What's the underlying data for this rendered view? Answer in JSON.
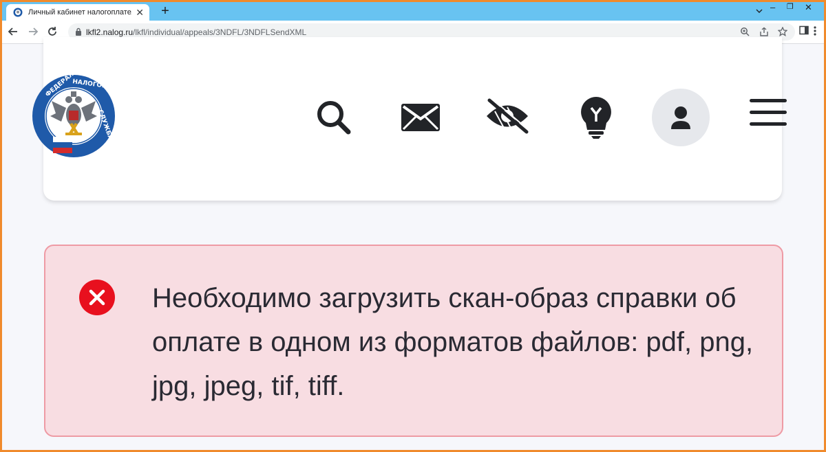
{
  "browser": {
    "tab_title": "Личный кабинет налогоплательщика",
    "tab_close": "✕",
    "new_tab": "+",
    "url_host": "lkfl2.nalog.ru",
    "url_path": "/lkfl/individual/appeals/3NDFL/3NDFLSendXML",
    "controls": {
      "minimize": "–",
      "maximize": "❐",
      "close": "✕"
    }
  },
  "header": {
    "logo_alt": "ФЕДЕРАЛЬНАЯ НАЛОГОВАЯ СЛУЖБА",
    "icons": [
      "search-icon",
      "mail-icon",
      "visually-impaired-icon",
      "lightbulb-icon",
      "profile-icon",
      "menu-icon"
    ]
  },
  "alert": {
    "type": "error",
    "message": "Необходимо загрузить скан-образ справки об оплате в одном из форматов файлов: pdf, png, jpg, jpeg, tif, tiff.",
    "color": "#e8101e"
  },
  "colors": {
    "frame": "#f08a2c",
    "tabstrip": "#68c3f1",
    "alert_bg": "#f8dde2",
    "alert_border": "#ee9aa4"
  }
}
